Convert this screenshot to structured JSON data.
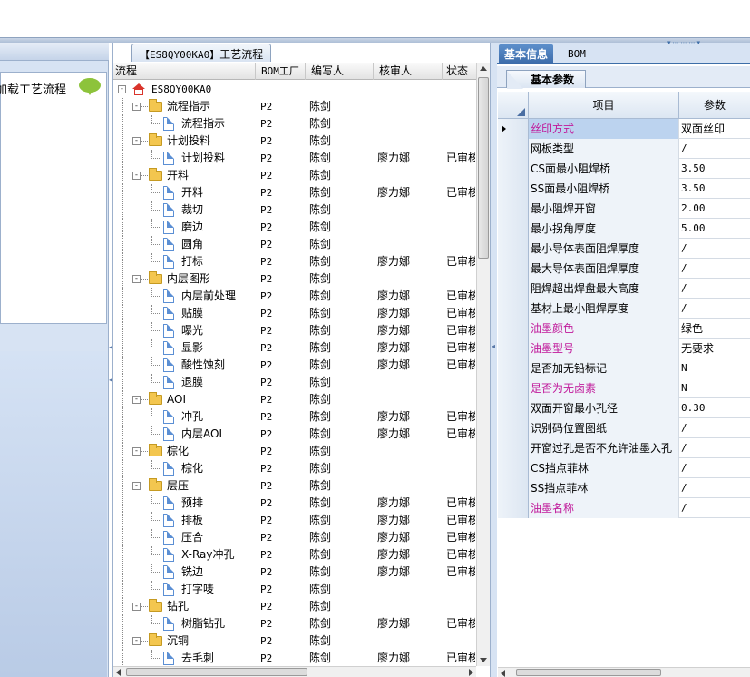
{
  "left": {
    "label": "加载工艺流程"
  },
  "center": {
    "title_code": "【ES8QY00KA0】",
    "title_text": "工艺流程",
    "columns": [
      "流程",
      "BOM工厂",
      "编写人",
      "核审人",
      "状态"
    ],
    "rows": [
      {
        "name": "ES8QY00KA0",
        "level": 0,
        "icon": "home-icon",
        "bom": "",
        "writer": "",
        "reviewer": "",
        "status": ""
      },
      {
        "name": "流程指示",
        "level": 1,
        "icon": "folder-icon",
        "bom": "P2",
        "writer": "陈剑",
        "reviewer": "",
        "status": ""
      },
      {
        "name": "流程指示",
        "level": 2,
        "icon": "document-icon",
        "bom": "P2",
        "writer": "陈剑",
        "reviewer": "",
        "status": ""
      },
      {
        "name": "计划投料",
        "level": 1,
        "icon": "folder-icon",
        "bom": "P2",
        "writer": "陈剑",
        "reviewer": "",
        "status": ""
      },
      {
        "name": "计划投料",
        "level": 2,
        "icon": "document-icon",
        "bom": "P2",
        "writer": "陈剑",
        "reviewer": "廖力娜",
        "status": "已审核"
      },
      {
        "name": "开料",
        "level": 1,
        "icon": "folder-icon",
        "bom": "P2",
        "writer": "陈剑",
        "reviewer": "",
        "status": ""
      },
      {
        "name": "开料",
        "level": 2,
        "icon": "document-icon",
        "bom": "P2",
        "writer": "陈剑",
        "reviewer": "廖力娜",
        "status": "已审核"
      },
      {
        "name": "裁切",
        "level": 2,
        "icon": "document-icon",
        "bom": "P2",
        "writer": "陈剑",
        "reviewer": "",
        "status": ""
      },
      {
        "name": "磨边",
        "level": 2,
        "icon": "document-icon",
        "bom": "P2",
        "writer": "陈剑",
        "reviewer": "",
        "status": ""
      },
      {
        "name": "圆角",
        "level": 2,
        "icon": "document-icon",
        "bom": "P2",
        "writer": "陈剑",
        "reviewer": "",
        "status": ""
      },
      {
        "name": "打标",
        "level": 2,
        "icon": "document-icon",
        "bom": "P2",
        "writer": "陈剑",
        "reviewer": "廖力娜",
        "status": "已审核"
      },
      {
        "name": "内层图形",
        "level": 1,
        "icon": "folder-icon",
        "bom": "P2",
        "writer": "陈剑",
        "reviewer": "",
        "status": ""
      },
      {
        "name": "内层前处理",
        "level": 2,
        "icon": "document-icon",
        "bom": "P2",
        "writer": "陈剑",
        "reviewer": "廖力娜",
        "status": "已审核"
      },
      {
        "name": "贴膜",
        "level": 2,
        "icon": "document-icon",
        "bom": "P2",
        "writer": "陈剑",
        "reviewer": "廖力娜",
        "status": "已审核"
      },
      {
        "name": "曝光",
        "level": 2,
        "icon": "document-icon",
        "bom": "P2",
        "writer": "陈剑",
        "reviewer": "廖力娜",
        "status": "已审核"
      },
      {
        "name": "显影",
        "level": 2,
        "icon": "document-icon",
        "bom": "P2",
        "writer": "陈剑",
        "reviewer": "廖力娜",
        "status": "已审核"
      },
      {
        "name": "酸性蚀刻",
        "level": 2,
        "icon": "document-icon",
        "bom": "P2",
        "writer": "陈剑",
        "reviewer": "廖力娜",
        "status": "已审核"
      },
      {
        "name": "退膜",
        "level": 2,
        "icon": "document-icon",
        "bom": "P2",
        "writer": "陈剑",
        "reviewer": "",
        "status": ""
      },
      {
        "name": "AOI",
        "level": 1,
        "icon": "folder-icon",
        "bom": "P2",
        "writer": "陈剑",
        "reviewer": "",
        "status": ""
      },
      {
        "name": "冲孔",
        "level": 2,
        "icon": "document-icon",
        "bom": "P2",
        "writer": "陈剑",
        "reviewer": "廖力娜",
        "status": "已审核"
      },
      {
        "name": "内层AOI",
        "level": 2,
        "icon": "document-icon",
        "bom": "P2",
        "writer": "陈剑",
        "reviewer": "廖力娜",
        "status": "已审核"
      },
      {
        "name": "棕化",
        "level": 1,
        "icon": "folder-icon",
        "bom": "P2",
        "writer": "陈剑",
        "reviewer": "",
        "status": ""
      },
      {
        "name": "棕化",
        "level": 2,
        "icon": "document-icon",
        "bom": "P2",
        "writer": "陈剑",
        "reviewer": "",
        "status": ""
      },
      {
        "name": "层压",
        "level": 1,
        "icon": "folder-icon",
        "bom": "P2",
        "writer": "陈剑",
        "reviewer": "",
        "status": ""
      },
      {
        "name": "预排",
        "level": 2,
        "icon": "document-icon",
        "bom": "P2",
        "writer": "陈剑",
        "reviewer": "廖力娜",
        "status": "已审核"
      },
      {
        "name": "排板",
        "level": 2,
        "icon": "document-icon",
        "bom": "P2",
        "writer": "陈剑",
        "reviewer": "廖力娜",
        "status": "已审核"
      },
      {
        "name": "压合",
        "level": 2,
        "icon": "document-icon",
        "bom": "P2",
        "writer": "陈剑",
        "reviewer": "廖力娜",
        "status": "已审核"
      },
      {
        "name": "X-Ray冲孔",
        "level": 2,
        "icon": "document-icon",
        "bom": "P2",
        "writer": "陈剑",
        "reviewer": "廖力娜",
        "status": "已审核"
      },
      {
        "name": "铣边",
        "level": 2,
        "icon": "document-icon",
        "bom": "P2",
        "writer": "陈剑",
        "reviewer": "廖力娜",
        "status": "已审核"
      },
      {
        "name": "打字唛",
        "level": 2,
        "icon": "document-icon",
        "bom": "P2",
        "writer": "陈剑",
        "reviewer": "",
        "status": ""
      },
      {
        "name": "钻孔",
        "level": 1,
        "icon": "folder-icon",
        "bom": "P2",
        "writer": "陈剑",
        "reviewer": "",
        "status": ""
      },
      {
        "name": "树脂钻孔",
        "level": 2,
        "icon": "document-icon",
        "bom": "P2",
        "writer": "陈剑",
        "reviewer": "廖力娜",
        "status": "已审核"
      },
      {
        "name": "沉铜",
        "level": 1,
        "icon": "folder-icon",
        "bom": "P2",
        "writer": "陈剑",
        "reviewer": "",
        "status": ""
      },
      {
        "name": "去毛刺",
        "level": 2,
        "icon": "document-icon",
        "bom": "P2",
        "writer": "陈剑",
        "reviewer": "廖力娜",
        "status": "已审核"
      }
    ]
  },
  "right": {
    "tabs": [
      "基本信息",
      "BOM"
    ],
    "active_tab": "基本信息",
    "subtab": "基本参数",
    "grid_headers": [
      "项目",
      "参数"
    ],
    "params": [
      {
        "item": "丝印方式",
        "value": "双面丝印",
        "pink": true,
        "selected": true
      },
      {
        "item": "网板类型",
        "value": "/",
        "pink": false
      },
      {
        "item": "CS面最小阻焊桥",
        "value": "3.50",
        "pink": false
      },
      {
        "item": "SS面最小阻焊桥",
        "value": "3.50",
        "pink": false
      },
      {
        "item": "最小阻焊开窗",
        "value": "2.00",
        "pink": false
      },
      {
        "item": "最小拐角厚度",
        "value": "5.00",
        "pink": false
      },
      {
        "item": "最小导体表面阻焊厚度",
        "value": "/",
        "pink": false
      },
      {
        "item": "最大导体表面阻焊厚度",
        "value": "/",
        "pink": false
      },
      {
        "item": "阻焊超出焊盘最大高度",
        "value": "/",
        "pink": false
      },
      {
        "item": "基材上最小阻焊厚度",
        "value": "/",
        "pink": false
      },
      {
        "item": "油墨颜色",
        "value": "绿色",
        "pink": true
      },
      {
        "item": "油墨型号",
        "value": "无要求",
        "pink": true
      },
      {
        "item": "是否加无铅标记",
        "value": "N",
        "pink": false
      },
      {
        "item": "是否为无卤素",
        "value": "N",
        "pink": true
      },
      {
        "item": "双面开窗最小孔径",
        "value": "0.30",
        "pink": false
      },
      {
        "item": "识别码位置图纸",
        "value": "/",
        "pink": false
      },
      {
        "item": "开窗过孔是否不允许油墨入孔",
        "value": "/",
        "pink": false
      },
      {
        "item": "CS挡点菲林",
        "value": "/",
        "pink": false
      },
      {
        "item": "SS挡点菲林",
        "value": "/",
        "pink": false
      },
      {
        "item": "油墨名称",
        "value": "/",
        "pink": true
      }
    ]
  },
  "colors": {
    "pink_text": "#c0189a",
    "accent": "#3d6ea8",
    "selected_row": "#bcd3ef"
  }
}
